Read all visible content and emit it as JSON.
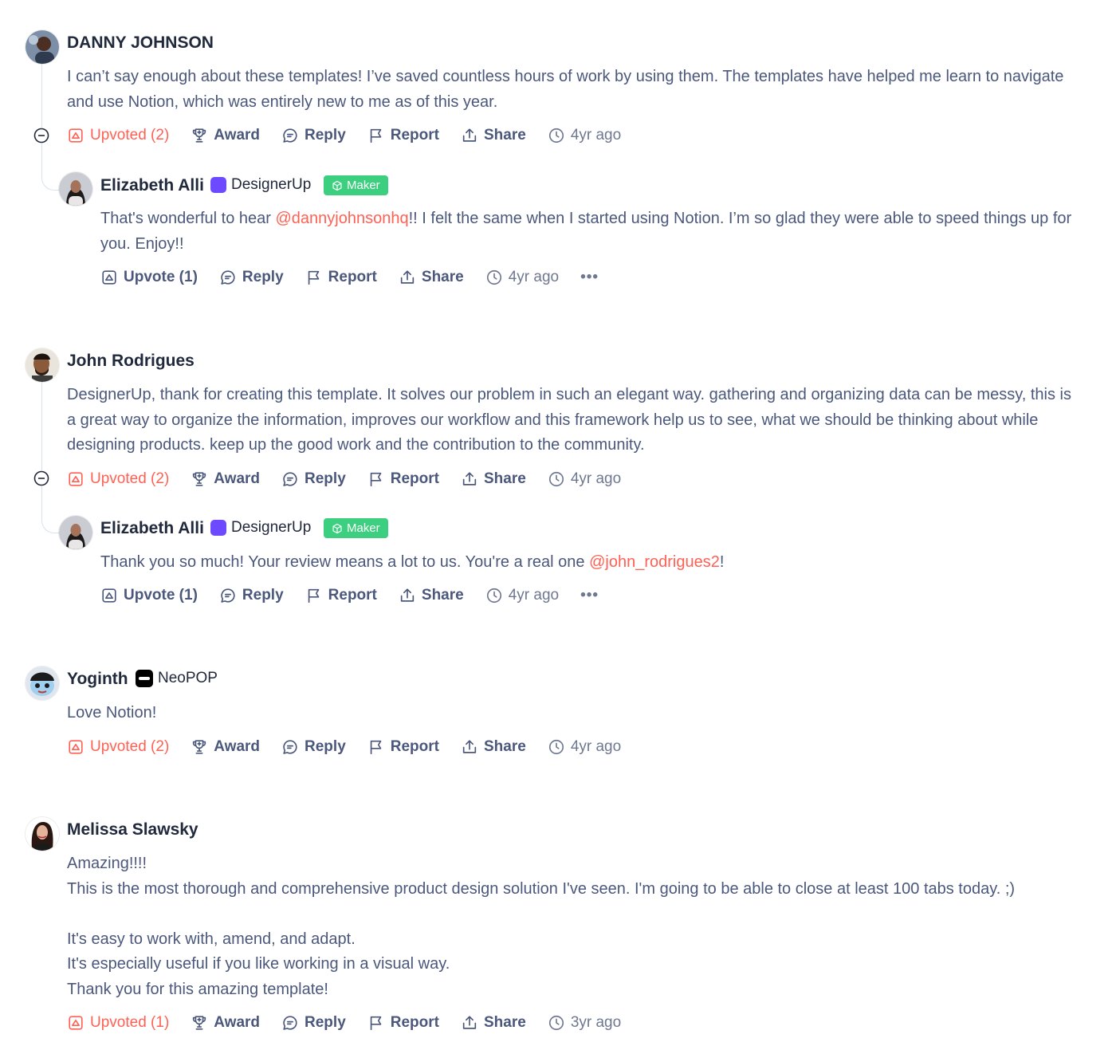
{
  "comments": [
    {
      "author": "DANNY JOHNSON",
      "body": [
        "I can’t say enough about these templates! I’ve saved countless hours of work by using them. The templates have helped me learn to navigate and use Notion, which was entirely new to me as of this year."
      ],
      "actions": {
        "upvote": "Upvoted (2)",
        "award": "Award",
        "reply": "Reply",
        "report": "Report",
        "share": "Share",
        "time": "4yr ago"
      },
      "reply": {
        "author": "Elizabeth Alli",
        "org": "DesignerUp",
        "badge": "Maker",
        "body_before": "That's wonderful to hear ",
        "mention": "@dannyjohnsonhq",
        "body_after": "!! I felt the same when I started using Notion. I’m so glad they were able to speed things up for you. Enjoy!!",
        "actions": {
          "upvote": "Upvote (1)",
          "reply": "Reply",
          "report": "Report",
          "share": "Share",
          "time": "4yr ago",
          "more": "•••"
        }
      }
    },
    {
      "author": "John Rodrigues",
      "body": [
        "DesignerUp, thank for creating this template. It solves our problem in such an elegant way. gathering and organizing data can be messy, this is a great way to organize the information, improves our workflow and this framework help us to see, what we should be thinking about while designing products. keep up the good work and the contribution to the community."
      ],
      "actions": {
        "upvote": "Upvoted (2)",
        "award": "Award",
        "reply": "Reply",
        "report": "Report",
        "share": "Share",
        "time": "4yr ago"
      },
      "reply": {
        "author": "Elizabeth Alli",
        "org": "DesignerUp",
        "badge": "Maker",
        "body_before": "Thank you so much! Your review means a lot to us. You're a real one ",
        "mention": "@john_rodrigues2",
        "body_after": "!",
        "actions": {
          "upvote": "Upvote (1)",
          "reply": "Reply",
          "report": "Report",
          "share": "Share",
          "time": "4yr ago",
          "more": "•••"
        }
      }
    },
    {
      "author": "Yoginth",
      "org": "NeoPOP",
      "body": [
        "Love Notion!"
      ],
      "actions": {
        "upvote": "Upvoted (2)",
        "award": "Award",
        "reply": "Reply",
        "report": "Report",
        "share": "Share",
        "time": "4yr ago"
      }
    },
    {
      "author": "Melissa Slawsky",
      "body": [
        "Amazing!!!!",
        "This is the most thorough and comprehensive product design solution I've seen. I'm going to be able to close at least 100 tabs today. ;)",
        "",
        "It's easy to work with, amend, and adapt.",
        "It's especially useful if you like working in a visual way.",
        "Thank you for this amazing template!"
      ],
      "actions": {
        "upvote": "Upvoted (1)",
        "award": "Award",
        "reply": "Reply",
        "report": "Report",
        "share": "Share",
        "time": "3yr ago"
      }
    }
  ],
  "colors": {
    "accent": "#ff6154",
    "maker_badge": "#3ccf7f",
    "designerup": "#6d4aff",
    "text": "#4b587c",
    "heading": "#21293c"
  },
  "icons": [
    "upvote-icon",
    "trophy-icon",
    "chat-bubble-icon",
    "flag-icon",
    "share-icon",
    "clock-icon",
    "collapse-icon",
    "cube-icon"
  ]
}
